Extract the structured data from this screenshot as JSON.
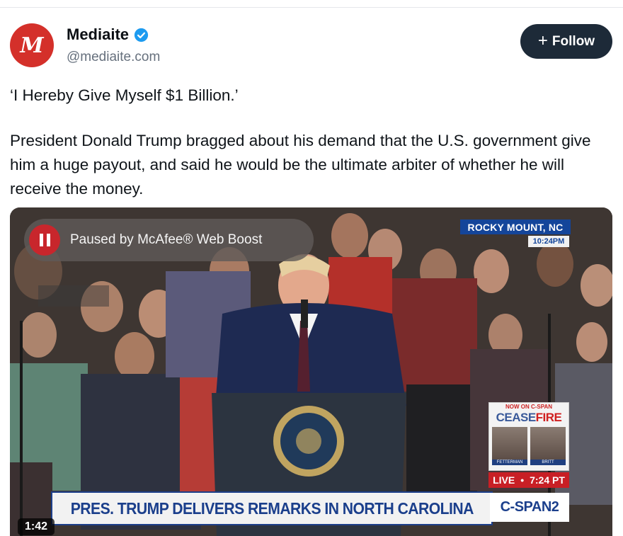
{
  "account": {
    "avatar_letter": "M",
    "avatar_color": "#d4302a",
    "name": "Mediaite",
    "verified_icon": "verified-check-icon",
    "verified_color": "#1d9bf0",
    "handle": "@mediaite.com"
  },
  "follow_button": {
    "icon": "plus-icon",
    "plus": "+",
    "label": "Follow"
  },
  "post": {
    "headline": "‘I Hereby Give Myself $1 Billion.’",
    "body": "President Donald Trump bragged about his demand that the U.S. government give him a huge payout, and said he would be the ultimate arbiter of whether he will receive the money."
  },
  "video": {
    "paused_overlay": {
      "icon": "pause-icon",
      "text": "Paused by McAfee® Web Boost"
    },
    "location": "ROCKY MOUNT, NC",
    "broadcast_time": "10:24PM",
    "sidebar_promo": {
      "label": "NOW ON C-SPAN",
      "title_part1": "CEASE",
      "title_part2": "FIRE",
      "guests": [
        "FETTERMAN",
        "BRITT"
      ]
    },
    "live_label": "LIVE",
    "live_time": "7:24 PT",
    "chyron": "PRES. TRUMP DELIVERS REMARKS IN NORTH CAROLINA",
    "network": "C-SPAN2",
    "duration": "1:42"
  }
}
